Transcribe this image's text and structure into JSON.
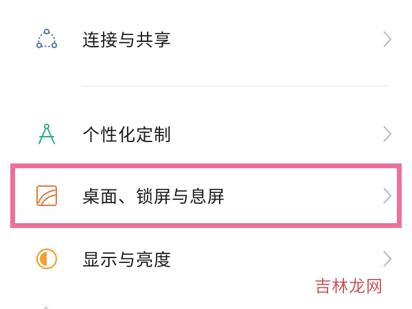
{
  "settings": {
    "items": [
      {
        "label": "连接与共享",
        "icon": "share-nodes-icon",
        "icon_color": "#5b7aa6"
      },
      {
        "label": "个性化定制",
        "icon": "compass-icon",
        "icon_color": "#2fae8a"
      },
      {
        "label": "桌面、锁屏与息屏",
        "icon": "wallpaper-icon",
        "icon_color": "#e07a3a"
      },
      {
        "label": "显示与亮度",
        "icon": "brightness-icon",
        "icon_color": "#f0a030"
      }
    ]
  },
  "highlight_color": "#ee6f98",
  "watermark": "吉林龙网"
}
